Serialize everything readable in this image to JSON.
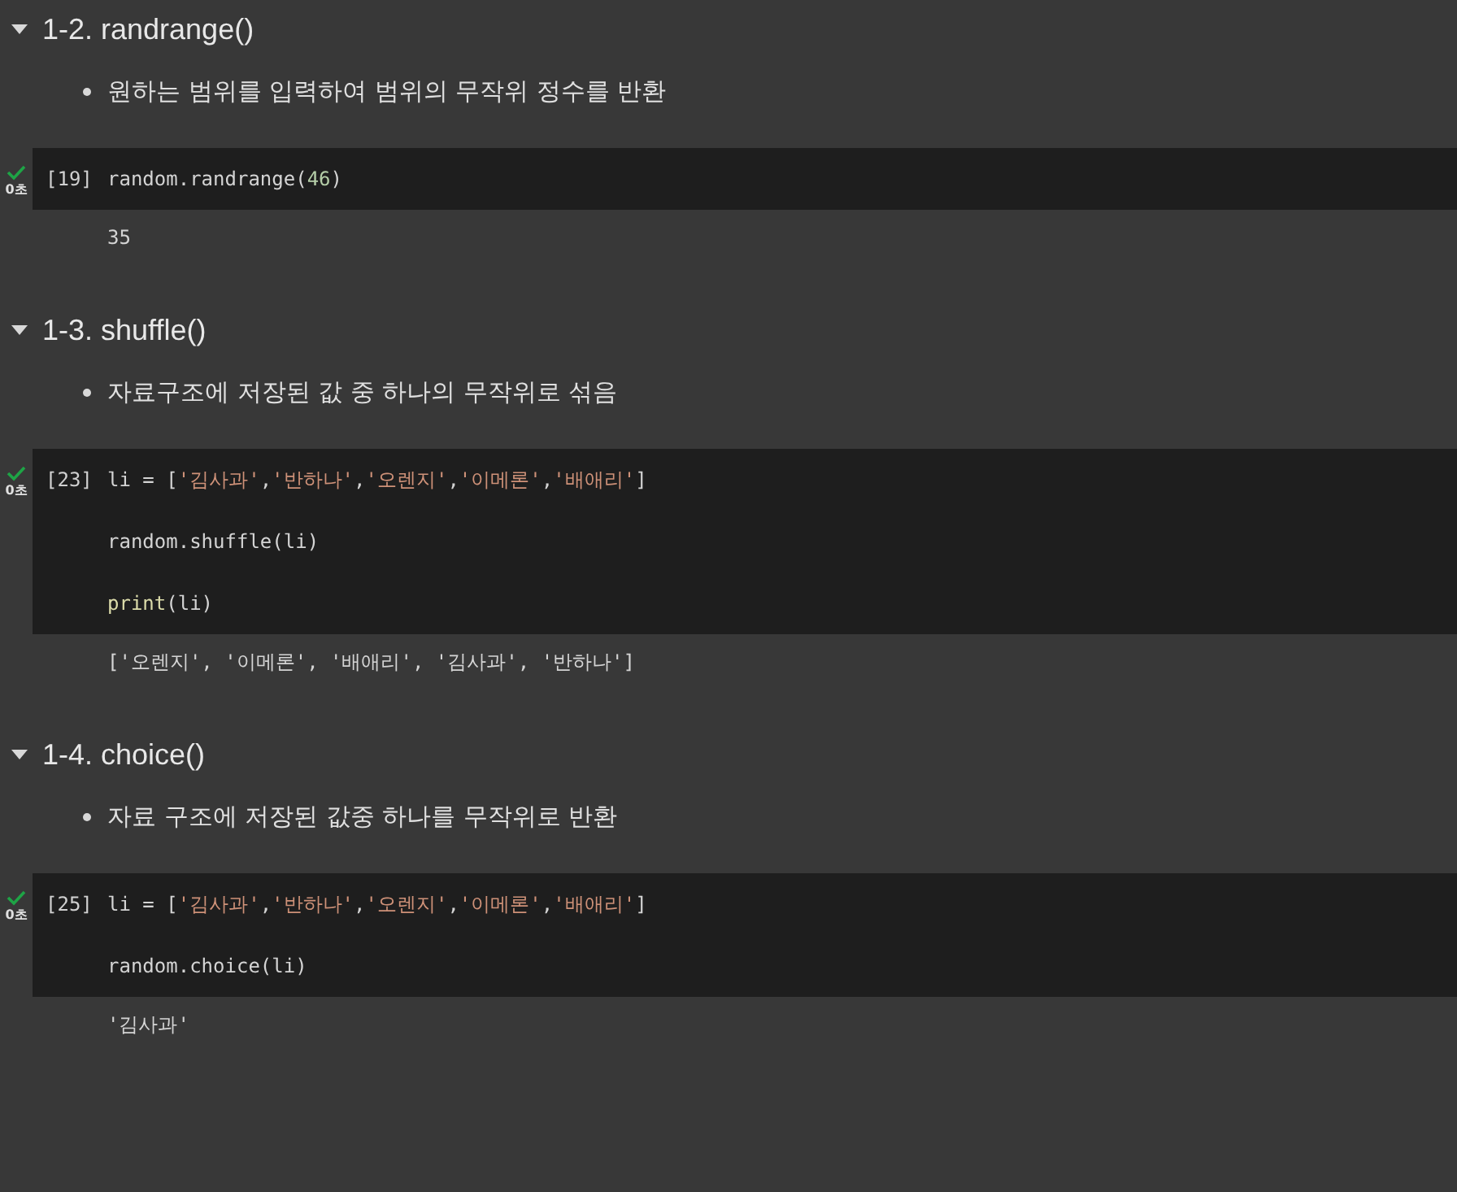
{
  "sections": [
    {
      "heading": "1-2. randrange()",
      "expanded": true,
      "bullet": "원하는 범위를 입력하여 범위의 무작위 정수를 반환",
      "cell": {
        "succeeded": true,
        "time": "0초",
        "count": "[19]",
        "lines": [
          [
            {
              "kind": "text",
              "text": "random.randrange("
            },
            {
              "kind": "number",
              "text": "46"
            },
            {
              "kind": "text",
              "text": ")"
            }
          ]
        ],
        "output": "35"
      }
    },
    {
      "heading": "1-3. shuffle()",
      "expanded": true,
      "bullet": "자료구조에 저장된 값 중 하나의 무작위로 섞음",
      "cell": {
        "succeeded": true,
        "time": "0초",
        "count": "[23]",
        "lines": [
          [
            {
              "kind": "text",
              "text": "li = ["
            },
            {
              "kind": "string",
              "text": "'김사과'"
            },
            {
              "kind": "text",
              "text": ","
            },
            {
              "kind": "string",
              "text": "'반하나'"
            },
            {
              "kind": "text",
              "text": ","
            },
            {
              "kind": "string",
              "text": "'오렌지'"
            },
            {
              "kind": "text",
              "text": ","
            },
            {
              "kind": "string",
              "text": "'이메론'"
            },
            {
              "kind": "text",
              "text": ","
            },
            {
              "kind": "string",
              "text": "'배애리'"
            },
            {
              "kind": "text",
              "text": "]"
            }
          ],
          [
            {
              "kind": "text",
              "text": "random.shuffle(li)"
            }
          ],
          [
            {
              "kind": "builtin",
              "text": "print"
            },
            {
              "kind": "text",
              "text": "(li)"
            }
          ]
        ],
        "output": "['오렌지', '이메론', '배애리', '김사과', '반하나']"
      }
    },
    {
      "heading": "1-4. choice()",
      "expanded": true,
      "bullet": "자료 구조에 저장된 값중 하나를 무작위로 반환",
      "cell": {
        "succeeded": true,
        "time": "0초",
        "count": "[25]",
        "lines": [
          [
            {
              "kind": "text",
              "text": "li = ["
            },
            {
              "kind": "string",
              "text": "'김사과'"
            },
            {
              "kind": "text",
              "text": ","
            },
            {
              "kind": "string",
              "text": "'반하나'"
            },
            {
              "kind": "text",
              "text": ","
            },
            {
              "kind": "string",
              "text": "'오렌지'"
            },
            {
              "kind": "text",
              "text": ","
            },
            {
              "kind": "string",
              "text": "'이메론'"
            },
            {
              "kind": "text",
              "text": ","
            },
            {
              "kind": "string",
              "text": "'배애리'"
            },
            {
              "kind": "text",
              "text": "]"
            }
          ],
          [
            {
              "kind": "text",
              "text": "random.choice(li)"
            }
          ]
        ],
        "output": "'김사과'"
      }
    }
  ]
}
